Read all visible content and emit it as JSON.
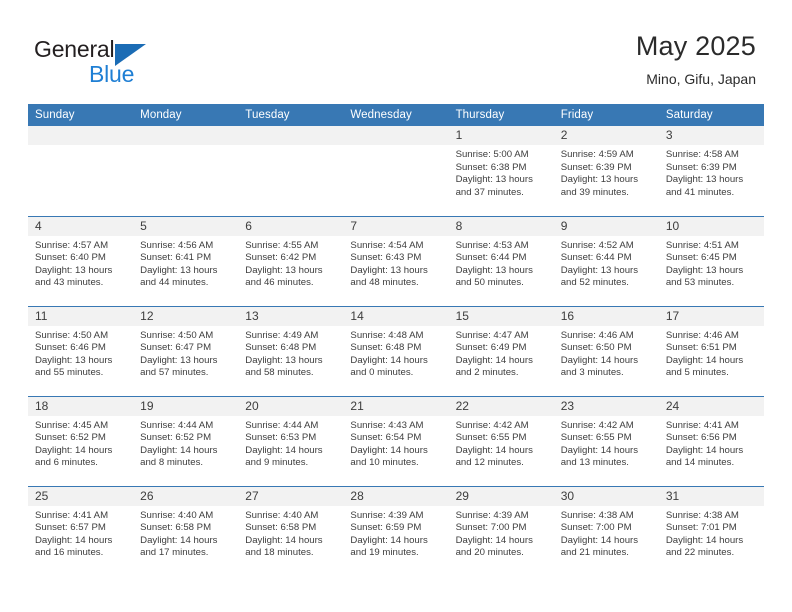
{
  "brand": {
    "name_part1": "General",
    "name_part2": "Blue",
    "triangle_color": "#1b6cb5",
    "blue_text_color": "#1f7fd4"
  },
  "header": {
    "title": "May 2025",
    "subtitle": "Mino, Gifu, Japan",
    "header_bg_color": "#3878b4",
    "daynum_bg_color": "#f2f2f2"
  },
  "weekdays": [
    "Sunday",
    "Monday",
    "Tuesday",
    "Wednesday",
    "Thursday",
    "Friday",
    "Saturday"
  ],
  "weeks": [
    [
      {
        "day": "",
        "blank": true,
        "sunrise": "",
        "sunset": "",
        "daylight1": "",
        "daylight2": ""
      },
      {
        "day": "",
        "blank": true,
        "sunrise": "",
        "sunset": "",
        "daylight1": "",
        "daylight2": ""
      },
      {
        "day": "",
        "blank": true,
        "sunrise": "",
        "sunset": "",
        "daylight1": "",
        "daylight2": ""
      },
      {
        "day": "",
        "blank": true,
        "sunrise": "",
        "sunset": "",
        "daylight1": "",
        "daylight2": ""
      },
      {
        "day": "1",
        "blank": false,
        "sunrise": "Sunrise: 5:00 AM",
        "sunset": "Sunset: 6:38 PM",
        "daylight1": "Daylight: 13 hours",
        "daylight2": "and 37 minutes."
      },
      {
        "day": "2",
        "blank": false,
        "sunrise": "Sunrise: 4:59 AM",
        "sunset": "Sunset: 6:39 PM",
        "daylight1": "Daylight: 13 hours",
        "daylight2": "and 39 minutes."
      },
      {
        "day": "3",
        "blank": false,
        "sunrise": "Sunrise: 4:58 AM",
        "sunset": "Sunset: 6:39 PM",
        "daylight1": "Daylight: 13 hours",
        "daylight2": "and 41 minutes."
      }
    ],
    [
      {
        "day": "4",
        "blank": false,
        "sunrise": "Sunrise: 4:57 AM",
        "sunset": "Sunset: 6:40 PM",
        "daylight1": "Daylight: 13 hours",
        "daylight2": "and 43 minutes."
      },
      {
        "day": "5",
        "blank": false,
        "sunrise": "Sunrise: 4:56 AM",
        "sunset": "Sunset: 6:41 PM",
        "daylight1": "Daylight: 13 hours",
        "daylight2": "and 44 minutes."
      },
      {
        "day": "6",
        "blank": false,
        "sunrise": "Sunrise: 4:55 AM",
        "sunset": "Sunset: 6:42 PM",
        "daylight1": "Daylight: 13 hours",
        "daylight2": "and 46 minutes."
      },
      {
        "day": "7",
        "blank": false,
        "sunrise": "Sunrise: 4:54 AM",
        "sunset": "Sunset: 6:43 PM",
        "daylight1": "Daylight: 13 hours",
        "daylight2": "and 48 minutes."
      },
      {
        "day": "8",
        "blank": false,
        "sunrise": "Sunrise: 4:53 AM",
        "sunset": "Sunset: 6:44 PM",
        "daylight1": "Daylight: 13 hours",
        "daylight2": "and 50 minutes."
      },
      {
        "day": "9",
        "blank": false,
        "sunrise": "Sunrise: 4:52 AM",
        "sunset": "Sunset: 6:44 PM",
        "daylight1": "Daylight: 13 hours",
        "daylight2": "and 52 minutes."
      },
      {
        "day": "10",
        "blank": false,
        "sunrise": "Sunrise: 4:51 AM",
        "sunset": "Sunset: 6:45 PM",
        "daylight1": "Daylight: 13 hours",
        "daylight2": "and 53 minutes."
      }
    ],
    [
      {
        "day": "11",
        "blank": false,
        "sunrise": "Sunrise: 4:50 AM",
        "sunset": "Sunset: 6:46 PM",
        "daylight1": "Daylight: 13 hours",
        "daylight2": "and 55 minutes."
      },
      {
        "day": "12",
        "blank": false,
        "sunrise": "Sunrise: 4:50 AM",
        "sunset": "Sunset: 6:47 PM",
        "daylight1": "Daylight: 13 hours",
        "daylight2": "and 57 minutes."
      },
      {
        "day": "13",
        "blank": false,
        "sunrise": "Sunrise: 4:49 AM",
        "sunset": "Sunset: 6:48 PM",
        "daylight1": "Daylight: 13 hours",
        "daylight2": "and 58 minutes."
      },
      {
        "day": "14",
        "blank": false,
        "sunrise": "Sunrise: 4:48 AM",
        "sunset": "Sunset: 6:48 PM",
        "daylight1": "Daylight: 14 hours",
        "daylight2": "and 0 minutes."
      },
      {
        "day": "15",
        "blank": false,
        "sunrise": "Sunrise: 4:47 AM",
        "sunset": "Sunset: 6:49 PM",
        "daylight1": "Daylight: 14 hours",
        "daylight2": "and 2 minutes."
      },
      {
        "day": "16",
        "blank": false,
        "sunrise": "Sunrise: 4:46 AM",
        "sunset": "Sunset: 6:50 PM",
        "daylight1": "Daylight: 14 hours",
        "daylight2": "and 3 minutes."
      },
      {
        "day": "17",
        "blank": false,
        "sunrise": "Sunrise: 4:46 AM",
        "sunset": "Sunset: 6:51 PM",
        "daylight1": "Daylight: 14 hours",
        "daylight2": "and 5 minutes."
      }
    ],
    [
      {
        "day": "18",
        "blank": false,
        "sunrise": "Sunrise: 4:45 AM",
        "sunset": "Sunset: 6:52 PM",
        "daylight1": "Daylight: 14 hours",
        "daylight2": "and 6 minutes."
      },
      {
        "day": "19",
        "blank": false,
        "sunrise": "Sunrise: 4:44 AM",
        "sunset": "Sunset: 6:52 PM",
        "daylight1": "Daylight: 14 hours",
        "daylight2": "and 8 minutes."
      },
      {
        "day": "20",
        "blank": false,
        "sunrise": "Sunrise: 4:44 AM",
        "sunset": "Sunset: 6:53 PM",
        "daylight1": "Daylight: 14 hours",
        "daylight2": "and 9 minutes."
      },
      {
        "day": "21",
        "blank": false,
        "sunrise": "Sunrise: 4:43 AM",
        "sunset": "Sunset: 6:54 PM",
        "daylight1": "Daylight: 14 hours",
        "daylight2": "and 10 minutes."
      },
      {
        "day": "22",
        "blank": false,
        "sunrise": "Sunrise: 4:42 AM",
        "sunset": "Sunset: 6:55 PM",
        "daylight1": "Daylight: 14 hours",
        "daylight2": "and 12 minutes."
      },
      {
        "day": "23",
        "blank": false,
        "sunrise": "Sunrise: 4:42 AM",
        "sunset": "Sunset: 6:55 PM",
        "daylight1": "Daylight: 14 hours",
        "daylight2": "and 13 minutes."
      },
      {
        "day": "24",
        "blank": false,
        "sunrise": "Sunrise: 4:41 AM",
        "sunset": "Sunset: 6:56 PM",
        "daylight1": "Daylight: 14 hours",
        "daylight2": "and 14 minutes."
      }
    ],
    [
      {
        "day": "25",
        "blank": false,
        "sunrise": "Sunrise: 4:41 AM",
        "sunset": "Sunset: 6:57 PM",
        "daylight1": "Daylight: 14 hours",
        "daylight2": "and 16 minutes."
      },
      {
        "day": "26",
        "blank": false,
        "sunrise": "Sunrise: 4:40 AM",
        "sunset": "Sunset: 6:58 PM",
        "daylight1": "Daylight: 14 hours",
        "daylight2": "and 17 minutes."
      },
      {
        "day": "27",
        "blank": false,
        "sunrise": "Sunrise: 4:40 AM",
        "sunset": "Sunset: 6:58 PM",
        "daylight1": "Daylight: 14 hours",
        "daylight2": "and 18 minutes."
      },
      {
        "day": "28",
        "blank": false,
        "sunrise": "Sunrise: 4:39 AM",
        "sunset": "Sunset: 6:59 PM",
        "daylight1": "Daylight: 14 hours",
        "daylight2": "and 19 minutes."
      },
      {
        "day": "29",
        "blank": false,
        "sunrise": "Sunrise: 4:39 AM",
        "sunset": "Sunset: 7:00 PM",
        "daylight1": "Daylight: 14 hours",
        "daylight2": "and 20 minutes."
      },
      {
        "day": "30",
        "blank": false,
        "sunrise": "Sunrise: 4:38 AM",
        "sunset": "Sunset: 7:00 PM",
        "daylight1": "Daylight: 14 hours",
        "daylight2": "and 21 minutes."
      },
      {
        "day": "31",
        "blank": false,
        "sunrise": "Sunrise: 4:38 AM",
        "sunset": "Sunset: 7:01 PM",
        "daylight1": "Daylight: 14 hours",
        "daylight2": "and 22 minutes."
      }
    ]
  ]
}
